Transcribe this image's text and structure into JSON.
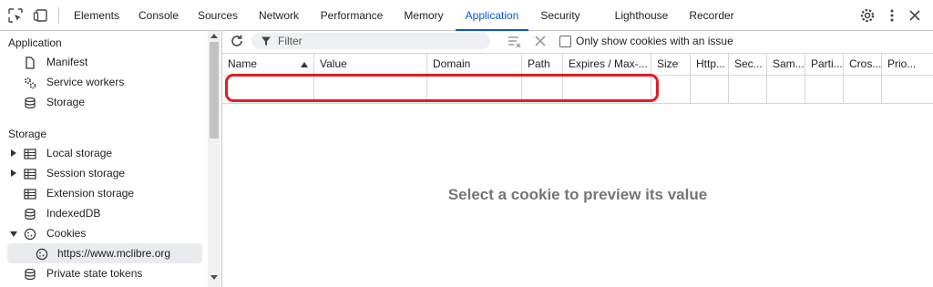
{
  "tabs": [
    "Elements",
    "Console",
    "Sources",
    "Network",
    "Performance",
    "Memory",
    "Application",
    "Security",
    "Lighthouse",
    "Recorder"
  ],
  "active_tab": "Application",
  "sidebar": {
    "application_title": "Application",
    "application_items": [
      "Manifest",
      "Service workers",
      "Storage"
    ],
    "storage_title": "Storage",
    "storage_items": [
      "Local storage",
      "Session storage",
      "Extension storage",
      "IndexedDB",
      "Cookies"
    ],
    "cookie_origin": "https://www.mclibre.org",
    "last_item": "Private state tokens"
  },
  "toolbar": {
    "filter_placeholder": "Filter",
    "only_issues_label": "Only show cookies with an issue",
    "only_issues_checked": false
  },
  "table": {
    "columns": [
      "Name",
      "Value",
      "Domain",
      "Path",
      "Expires / Max-...",
      "Size",
      "Http...",
      "Sec...",
      "Sam...",
      "Parti...",
      "Cros...",
      "Prio..."
    ],
    "sorted_column": "Name",
    "sort_direction": "ascending"
  },
  "empty_message": "Select a cookie to preview its value",
  "colors": {
    "accent": "#0b57d0",
    "highlight": "#e31b23",
    "muted": "#767676"
  }
}
